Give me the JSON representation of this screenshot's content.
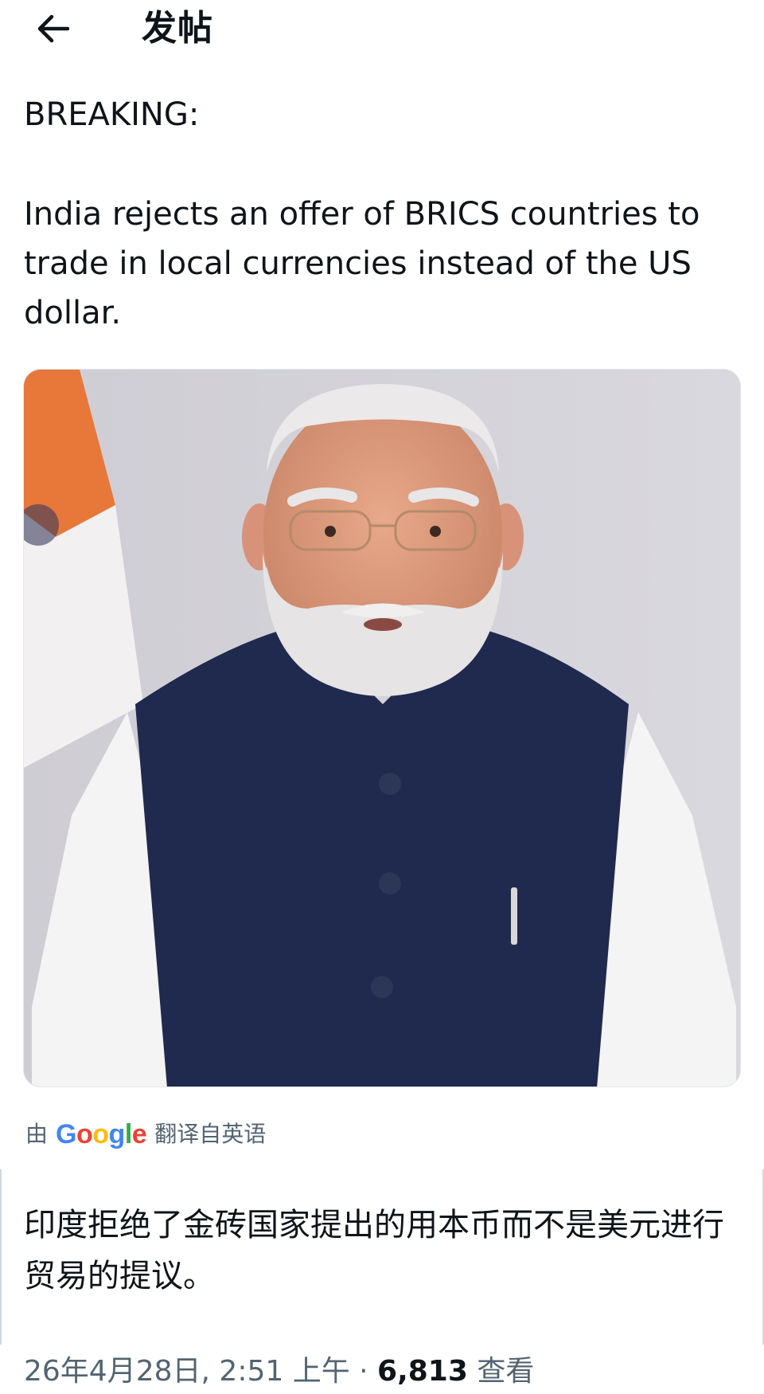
{
  "header": {
    "back_icon": "arrow-left-icon",
    "title": "发帖"
  },
  "tweet": {
    "label": "BREAKING:",
    "text": "India rejects an offer of BRICS countries to trade in local currencies instead of the US dollar.",
    "media_alt": "photo-portrait"
  },
  "translation": {
    "prefix": "由",
    "brand": [
      "G",
      "o",
      "o",
      "g",
      "l",
      "e"
    ],
    "suffix": "翻译自英语",
    "text": "印度拒绝了金砖国家提出的用本币而不是美元进行贸易的提议。"
  },
  "meta": {
    "datetime": "26年4月28日, 2:51 上午 · ",
    "views_count": "6,813",
    "views_label": " 查看"
  },
  "colors": {
    "text_primary": "#0f1419",
    "text_secondary": "#536471",
    "divider": "#cfd9de"
  }
}
